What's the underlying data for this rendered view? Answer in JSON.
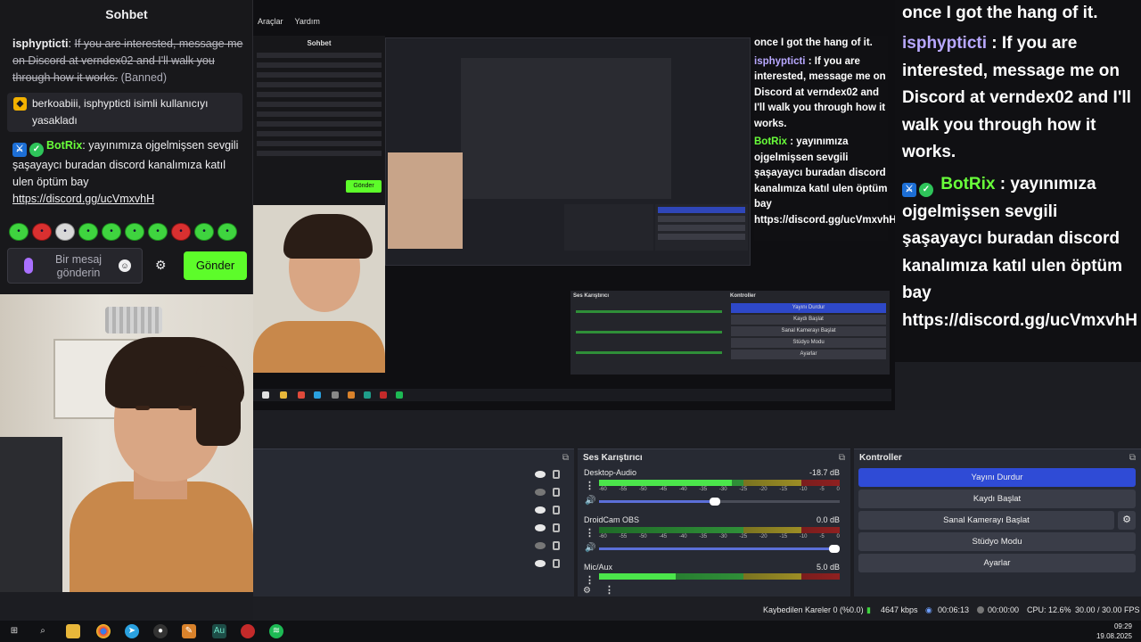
{
  "chat": {
    "title": "Sohbet",
    "msg1_user": "isphypticti",
    "msg1_text": "If you are interested, message me on Discord at verndex02 and I'll walk you through how it works.",
    "msg1_status": "(Banned)",
    "notice_text": "berkoabiii, isphypticti isimli kullanıcıyı yasakladı",
    "bot_user": "BotRix",
    "bot_text": "yayınımıza ojgelmişsen sevgili şaşayaycı buradan discord kanalımıza katıl ulen öptüm bay",
    "bot_link": "https://discord.gg/ucVmxvhH",
    "input_placeholder": "Bir mesaj gönderin",
    "send_label": "Gönder"
  },
  "obs_menu": {
    "tools": "Araçlar",
    "help": "Yardım"
  },
  "overlay": {
    "line_prev": "once I got the hang of it.",
    "user": "isphypticti",
    "user_text": "If you are interested, message me on Discord at verndex02 and I'll walk you through how it works.",
    "bot_user": "BotRix",
    "bot_text": "yayınımıza ojgelmişsen sevgili şaşayaycı buradan discord kanalımıza katıl ulen öptüm bay",
    "bot_link": "https://discord.gg/ucVmxvhH"
  },
  "mixer": {
    "title": "Ses Karıştırıcı",
    "channels": [
      {
        "name": "Desktop-Audio",
        "db": "-18.7 dB",
        "level": 0.55,
        "volume": 0.48
      },
      {
        "name": "DroidCam OBS",
        "db": "0.0 dB",
        "level": 0.0,
        "volume": 1.0
      },
      {
        "name": "Mic/Aux",
        "db": "5.0 dB",
        "level": 0.32,
        "volume": 0.6
      }
    ],
    "scale": [
      "-60",
      "-55",
      "-50",
      "-45",
      "-40",
      "-35",
      "-30",
      "-25",
      "-20",
      "-15",
      "-10",
      "-5",
      "0"
    ]
  },
  "controls": {
    "title": "Kontroller",
    "stop_stream": "Yayını Durdur",
    "start_record": "Kaydı Başlat",
    "start_virtual_cam": "Sanal Kamerayı Başlat",
    "studio_mode": "Stüdyo Modu",
    "settings": "Ayarlar"
  },
  "status": {
    "dropped_frames": "Kaybedilen Kareler 0 (%0.0)",
    "bitrate": "4647 kbps",
    "stream_time": "00:06:13",
    "record_time": "00:00:00",
    "cpu": "CPU: 12.6%",
    "fps": "30.00 / 30.00 FPS"
  },
  "taskbar": {
    "time": "09:29",
    "date": "19.08.2025"
  },
  "mini": {
    "chat_title": "Sohbet",
    "send": "Gönder",
    "overlay_prev": "once I got the hang of it.",
    "overlay_user": "isphypticti",
    "overlay_text": "If you are interested, message me on Discord at verndex02 and I'll walk you through how it works.",
    "overlay_bot": "BotRix",
    "overlay_bot_text": "yayınımıza ojgelmişsen sevgili şaşayaycı buradan discord kanalımıza katıl ulen öptüm bay",
    "overlay_link": "https://discord.gg/ucVmxvhH",
    "mixer_title": "Ses Karıştırıcı",
    "controls_title": "Kontroller",
    "ctl_stop": "Yayını Durdur",
    "ctl_record": "Kaydı Başlat",
    "ctl_cam": "Sanal Kamerayı Başlat",
    "ctl_studio": "Stüdyo Modu",
    "ctl_settings": "Ayarlar"
  },
  "colors": {
    "accent_green": "#5dfc2a",
    "stream_active": "#2f4bd6",
    "bot_name": "#69ff3a",
    "user_name": "#b8a8ff"
  }
}
